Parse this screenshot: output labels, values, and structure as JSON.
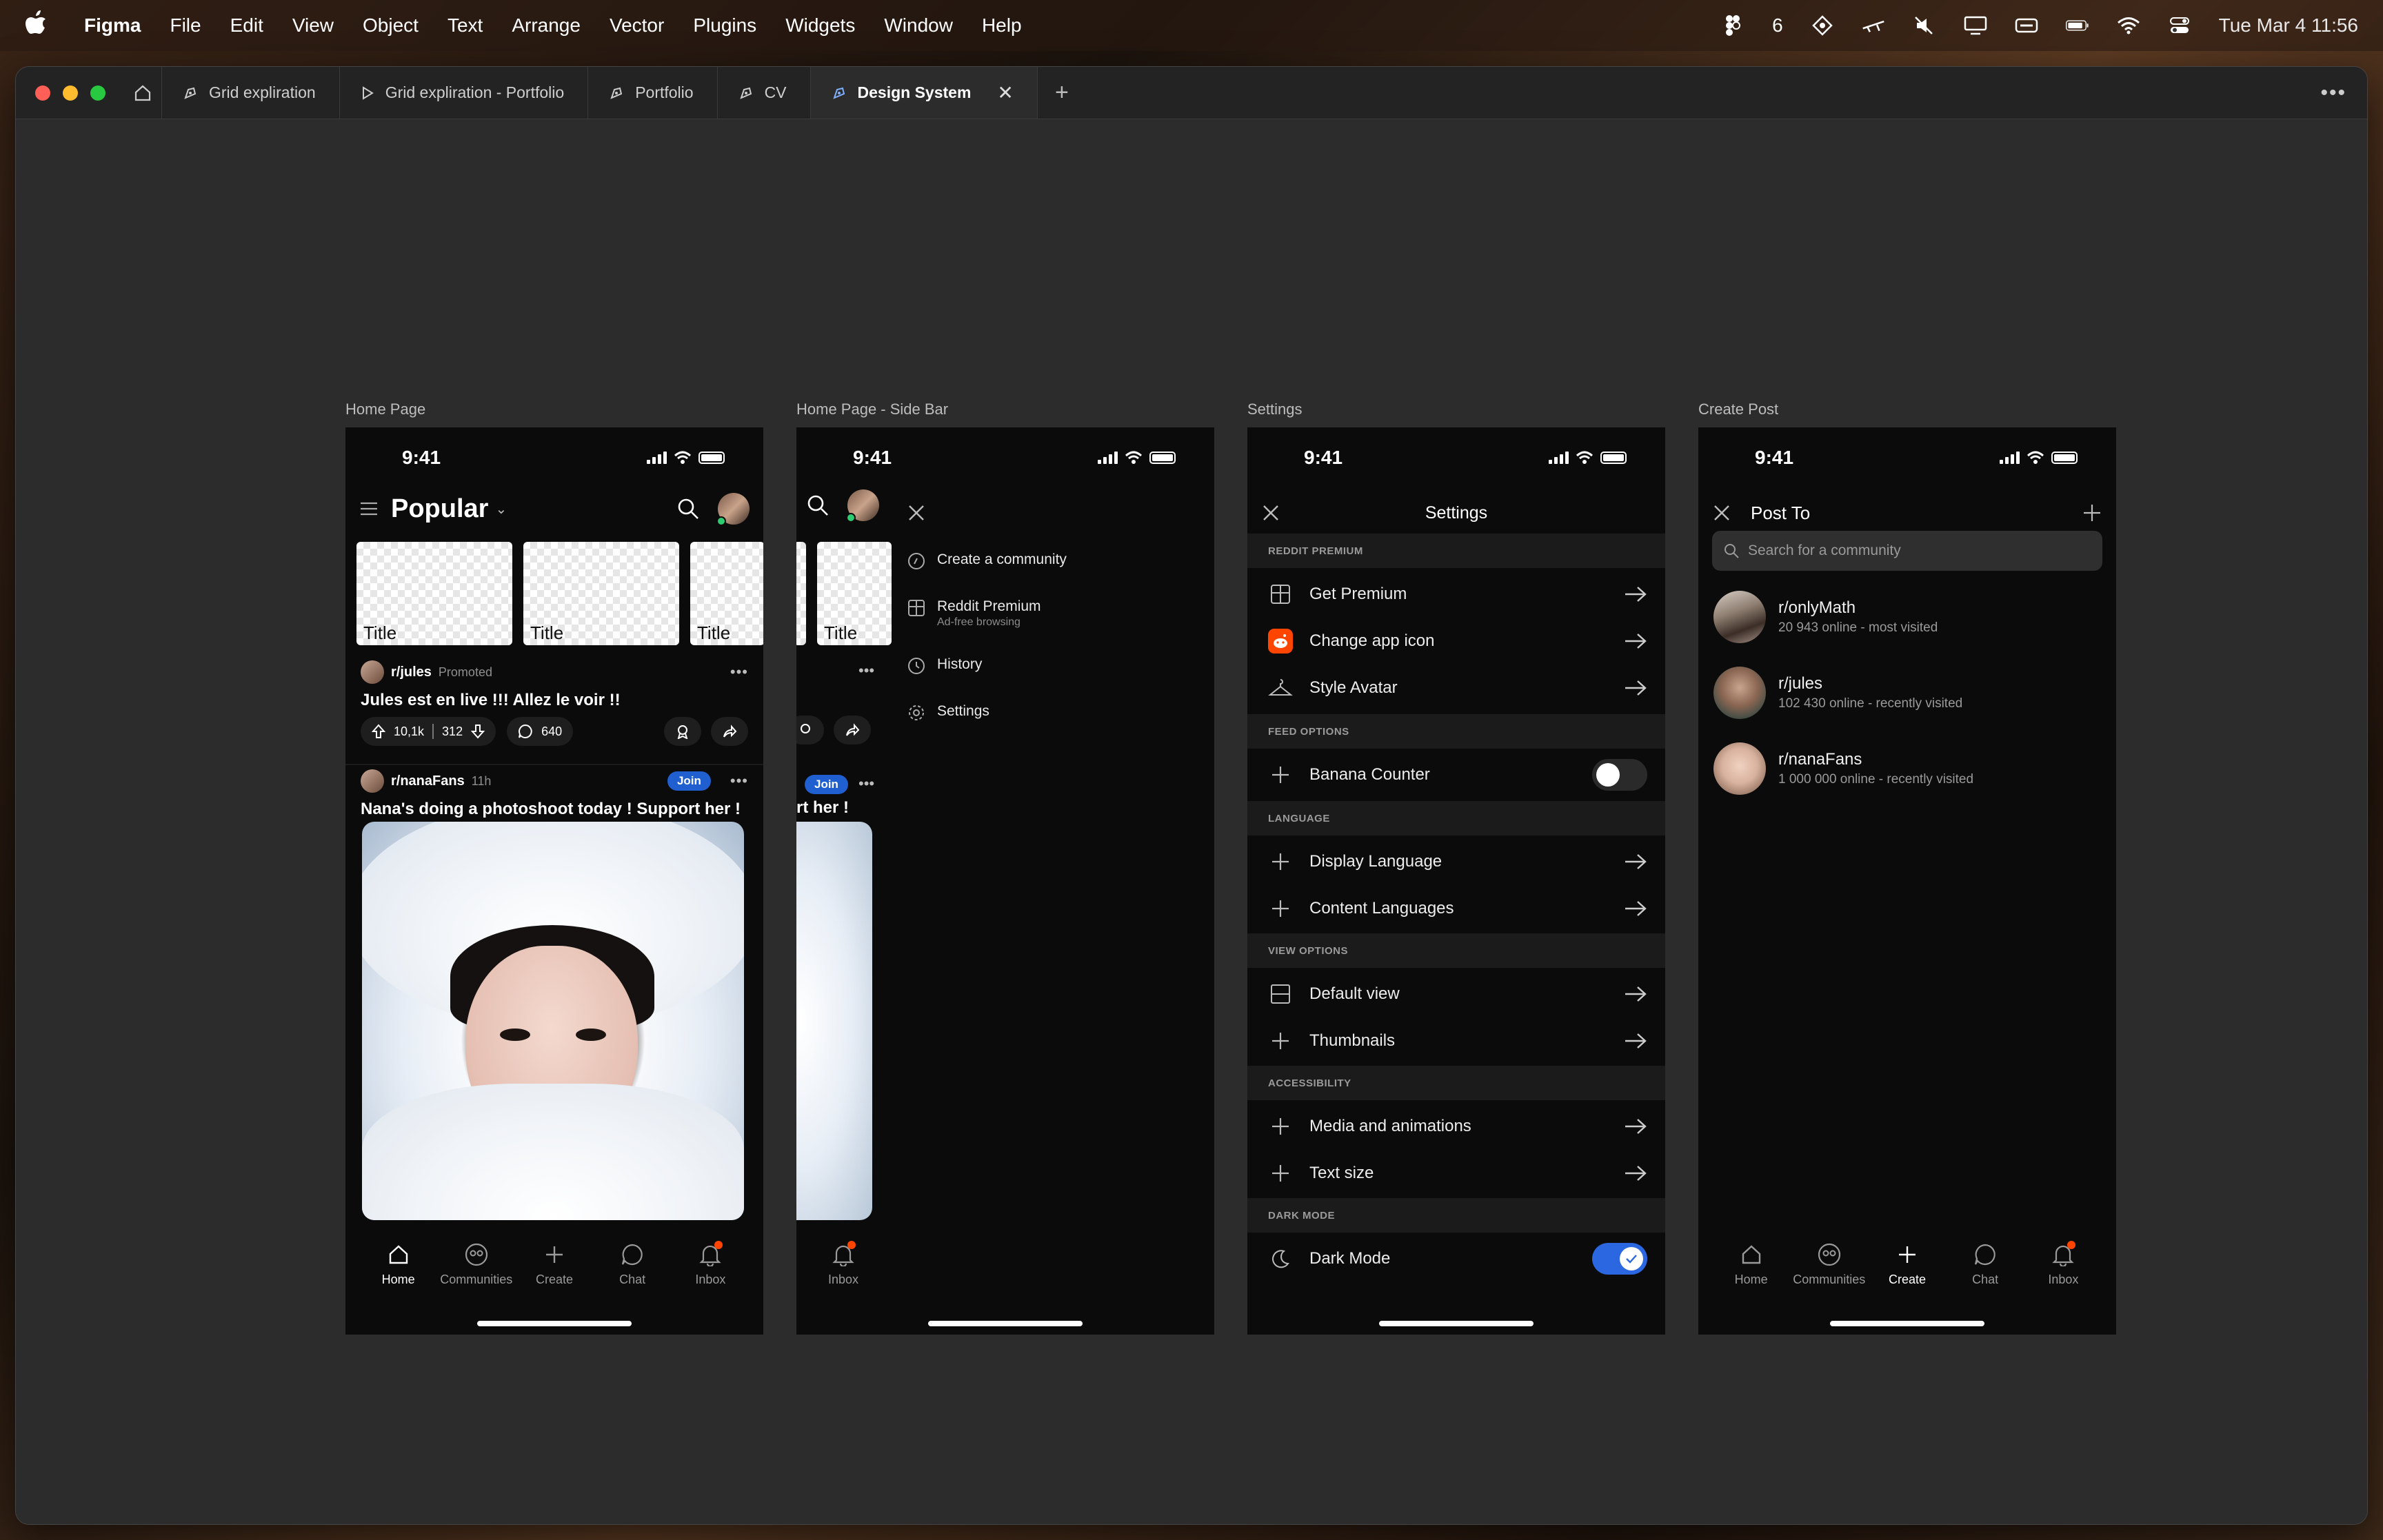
{
  "menubar": {
    "app": "Figma",
    "items": [
      "File",
      "Edit",
      "View",
      "Object",
      "Text",
      "Arrange",
      "Vector",
      "Plugins",
      "Widgets",
      "Window",
      "Help"
    ],
    "status_count": "6",
    "clock": "Tue Mar 4  11:56"
  },
  "tabs": [
    {
      "label": "Grid expliration",
      "kind": "design"
    },
    {
      "label": "Grid expliration - Portfolio",
      "kind": "prototype"
    },
    {
      "label": "Portfolio",
      "kind": "design"
    },
    {
      "label": "CV",
      "kind": "design"
    },
    {
      "label": "Design System",
      "kind": "design",
      "active": true
    }
  ],
  "frames": {
    "home": {
      "label": "Home Page"
    },
    "sidebar": {
      "label": "Home Page - Side Bar"
    },
    "settings": {
      "label": "Settings"
    },
    "create": {
      "label": "Create Post"
    }
  },
  "phone": {
    "time": "9:41"
  },
  "home": {
    "title": "Popular",
    "cards": [
      "Title",
      "Title",
      "Title"
    ],
    "post1": {
      "sub": "r/jules",
      "tag": "Promoted",
      "title": "Jules est en live !!! Allez le voir !!",
      "upvotes": "10,1k",
      "downvotes": "312",
      "comments": "640"
    },
    "post2": {
      "sub": "r/nanaFans",
      "age": "11h",
      "join": "Join",
      "title": "Nana's doing a photoshoot today ! Support her !"
    }
  },
  "nav": {
    "home": "Home",
    "communities": "Communities",
    "create": "Create",
    "chat": "Chat",
    "inbox": "Inbox"
  },
  "sidebar": {
    "cards": [
      "Title"
    ],
    "join": "Join",
    "post_title_fragment": "rt her !",
    "items": [
      {
        "label": "Create a community",
        "sub": ""
      },
      {
        "label": "Reddit Premium",
        "sub": "Ad-free browsing"
      },
      {
        "label": "History",
        "sub": ""
      },
      {
        "label": "Settings",
        "sub": ""
      }
    ],
    "inbox": "Inbox"
  },
  "settings": {
    "title": "Settings",
    "sections": {
      "premium": "REDDIT PREMIUM",
      "feed": "FEED OPTIONS",
      "language": "LANGUAGE",
      "view": "VIEW OPTIONS",
      "access": "ACCESSIBILITY",
      "dark": "DARK MODE"
    },
    "rows": {
      "get_premium": "Get Premium",
      "change_icon": "Change app icon",
      "style_avatar": "Style Avatar",
      "banana": "Banana Counter",
      "display_lang": "Display Language",
      "content_lang": "Content Languages",
      "default_view": "Default view",
      "thumbnails": "Thumbnails",
      "media": "Media and animations",
      "text_size": "Text size",
      "dark_mode": "Dark Mode"
    },
    "toggles": {
      "banana": false,
      "dark_mode": true
    }
  },
  "create": {
    "title": "Post To",
    "search_placeholder": "Search for a community",
    "communities": [
      {
        "name": "r/onlyMath",
        "info": "20 943 online - most visited"
      },
      {
        "name": "r/jules",
        "info": "102 430 online - recently visited"
      },
      {
        "name": "r/nanaFans",
        "info": "1 000 000 online - recently visited"
      }
    ]
  },
  "colors": {
    "accent_blue": "#2b67e0",
    "reddit_orange": "#ff4500",
    "frame_bg": "#0b0b0b",
    "canvas_bg": "#2c2c2c"
  }
}
